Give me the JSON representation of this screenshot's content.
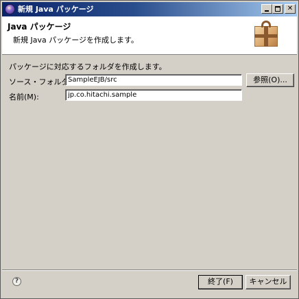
{
  "window": {
    "title": "新規 Java パッケージ"
  },
  "banner": {
    "title": "Java パッケージ",
    "message": "新規 Java パッケージを作成します。",
    "icon": "package-icon"
  },
  "form": {
    "description": "パッケージに対応するフォルダを作成します。",
    "source_folder_label": "ソース・フォルダ(D):",
    "source_folder_value": "SampleEJB/src",
    "browse_label": "参照(O)...",
    "name_label": "名前(M):",
    "name_value": "jp.co.hitachi.sample"
  },
  "footer": {
    "help_icon": "help-icon",
    "finish_label": "終了(F)",
    "cancel_label": "キャンセル"
  }
}
